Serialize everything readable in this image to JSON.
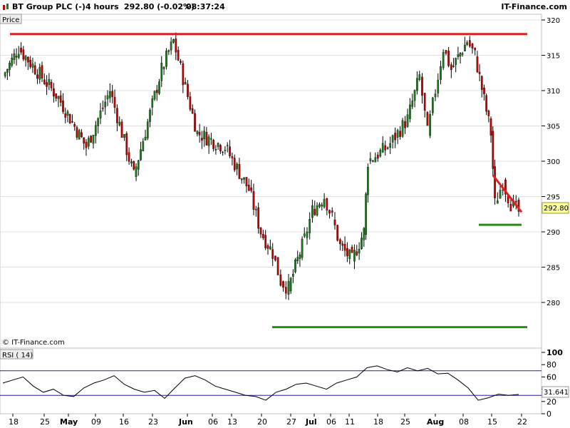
{
  "header": {
    "instrument": "BT Group PLC (-)",
    "interval": "4 hours",
    "price_change": "292.80 (-0.02%)",
    "time": "08:37:24",
    "brand": "IT-Finance.com"
  },
  "main_panel": {
    "label": "Price",
    "copyright": "© IT-Finance.com",
    "last_price_label": "292.80"
  },
  "rsi_panel": {
    "label": "RSI ( 14)",
    "last_value_label": "31.641",
    "y_ticks": [
      "100",
      "80",
      "60",
      "40",
      "20",
      "0"
    ]
  },
  "colors": {
    "up": "#1a7a1a",
    "down": "#c00000",
    "resistance": "#e02020",
    "support": "#2a8a1a",
    "rsi_line": "#000000",
    "rsi_bands": "#2020a0",
    "price_label_bg": "#ffff99"
  },
  "chart_data": [
    {
      "type": "candlestick",
      "title": "BT Group PLC (-)",
      "ylim": [
        275,
        320
      ],
      "y_ticks": [
        280,
        285,
        290,
        295,
        300,
        305,
        310,
        315,
        320
      ],
      "x_tick_labels": [
        "18",
        "25",
        "May",
        "09",
        "16",
        "23",
        "Jun",
        "06",
        "13",
        "20",
        "27",
        "Jul",
        "06",
        "11",
        "18",
        "25",
        "Aug",
        "08",
        "15",
        "22"
      ],
      "x_tick_bold": [
        "May",
        "Jun",
        "Jul",
        "Aug"
      ],
      "grid": true,
      "last_price": 292.8,
      "key_points": [
        {
          "date": "Apr 14",
          "price": 312
        },
        {
          "date": "Apr 18",
          "price": 316
        },
        {
          "date": "Apr 28",
          "price": 309
        },
        {
          "date": "May 05",
          "price": 302
        },
        {
          "date": "May 11",
          "price": 310
        },
        {
          "date": "May 17",
          "price": 298
        },
        {
          "date": "May 24",
          "price": 313
        },
        {
          "date": "May 27",
          "price": 317
        },
        {
          "date": "Jun 02",
          "price": 304
        },
        {
          "date": "Jun 09",
          "price": 302
        },
        {
          "date": "Jun 15",
          "price": 296
        },
        {
          "date": "Jun 18",
          "price": 290
        },
        {
          "date": "Jun 21",
          "price": 287
        },
        {
          "date": "Jun 23",
          "price": 283
        },
        {
          "date": "Jun 25",
          "price": 282
        },
        {
          "date": "Jun 29",
          "price": 289
        },
        {
          "date": "Jul 01",
          "price": 293
        },
        {
          "date": "Jul 04",
          "price": 295
        },
        {
          "date": "Jul 06",
          "price": 292
        },
        {
          "date": "Jul 08",
          "price": 288
        },
        {
          "date": "Jul 11",
          "price": 286
        },
        {
          "date": "Jul 14",
          "price": 290
        },
        {
          "date": "Jul 15",
          "price": 300
        },
        {
          "date": "Jul 20",
          "price": 302
        },
        {
          "date": "Jul 25",
          "price": 306
        },
        {
          "date": "Jul 28",
          "price": 312
        },
        {
          "date": "Jul 30",
          "price": 304
        },
        {
          "date": "Aug 01",
          "price": 310
        },
        {
          "date": "Aug 03",
          "price": 316
        },
        {
          "date": "Aug 05",
          "price": 313
        },
        {
          "date": "Aug 09",
          "price": 317
        },
        {
          "date": "Aug 11",
          "price": 315
        },
        {
          "date": "Aug 15",
          "price": 304
        },
        {
          "date": "Aug 16",
          "price": 294
        },
        {
          "date": "Aug 18",
          "price": 297
        },
        {
          "date": "Aug 20",
          "price": 294
        },
        {
          "date": "Aug 22",
          "price": 292.8
        }
      ],
      "annotations": [
        {
          "type": "resistance",
          "price": 318,
          "from": "Apr 14",
          "to": "Aug 22"
        },
        {
          "type": "support",
          "price": 276.5,
          "from": "Jun 24",
          "to": "Aug 22"
        },
        {
          "type": "support",
          "price": 291,
          "from": "Aug 17",
          "to": "Aug 27"
        },
        {
          "type": "trend",
          "from_date": "Aug 20",
          "from_price": 298,
          "to_date": "Aug 29",
          "to_price": 292.8
        }
      ]
    },
    {
      "type": "line",
      "title": "RSI ( 14)",
      "ylim": [
        0,
        100
      ],
      "y_ticks": [
        0,
        20,
        40,
        60,
        80,
        100
      ],
      "reference_lines": [
        70,
        30
      ],
      "last_value": 31.641,
      "values": [
        50,
        55,
        60,
        45,
        35,
        40,
        30,
        28,
        42,
        50,
        55,
        62,
        48,
        40,
        35,
        38,
        25,
        42,
        58,
        62,
        55,
        45,
        40,
        35,
        30,
        28,
        22,
        35,
        40,
        48,
        50,
        45,
        40,
        50,
        55,
        60,
        75,
        78,
        72,
        68,
        75,
        70,
        74,
        65,
        66,
        55,
        42,
        22,
        26,
        32,
        30,
        31.6
      ]
    }
  ]
}
